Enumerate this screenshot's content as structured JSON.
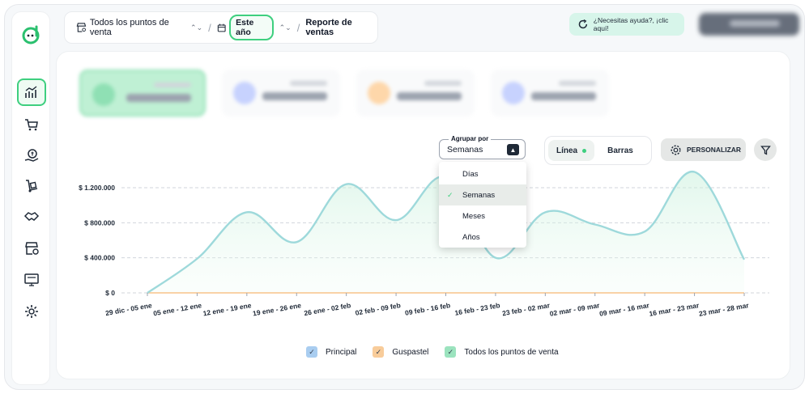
{
  "topbar": {
    "store": "Todos los puntos de venta",
    "period": "Este año",
    "report": "Reporte de ventas"
  },
  "help": {
    "label": "¿Necesitas ayuda?, ¡clic aquí!"
  },
  "controls": {
    "group_label": "Agrupar por",
    "group_value": "Semanas",
    "view_line": "Línea",
    "view_bars": "Barras",
    "customize": "PERSONALIZAR"
  },
  "dropdown": {
    "options": [
      "Días",
      "Semanas",
      "Meses",
      "Años"
    ],
    "selected": "Semanas"
  },
  "legend": [
    {
      "label": "Principal",
      "color": "#a9cdf0"
    },
    {
      "label": "Guspastel",
      "color": "#f8cc9a"
    },
    {
      "label": "Todos los puntos de venta",
      "color": "#9be3be"
    }
  ],
  "colors": {
    "accent": "#3ecf7f",
    "line": "#9ed9db",
    "orange": "#f8c48a"
  },
  "chart_data": {
    "type": "line",
    "categories": [
      "29 dic - 05 ene",
      "05 ene - 12 ene",
      "12 ene - 19 ene",
      "19 ene - 26 ene",
      "26 ene - 02 feb",
      "02 feb - 09 feb",
      "09 feb - 16 feb",
      "16 feb - 23 feb",
      "23 feb - 02 mar",
      "02 mar - 09 mar",
      "09 mar - 16 mar",
      "16 mar - 23 mar",
      "23 mar - 28 mar"
    ],
    "yticks": [
      "$ 0",
      "$ 400.000",
      "$ 800.000",
      "$ 1.200.000"
    ],
    "ylim": [
      0,
      1400000
    ],
    "series": [
      {
        "name": "Todos los puntos de venta",
        "values": [
          0,
          390000,
          920000,
          580000,
          1240000,
          830000,
          1320000,
          400000,
          920000,
          780000,
          700000,
          1380000,
          380000
        ]
      },
      {
        "name": "Guspastel",
        "values": [
          0,
          0,
          0,
          0,
          0,
          0,
          0,
          0,
          0,
          0,
          0,
          0,
          0
        ]
      }
    ],
    "grid": true
  }
}
